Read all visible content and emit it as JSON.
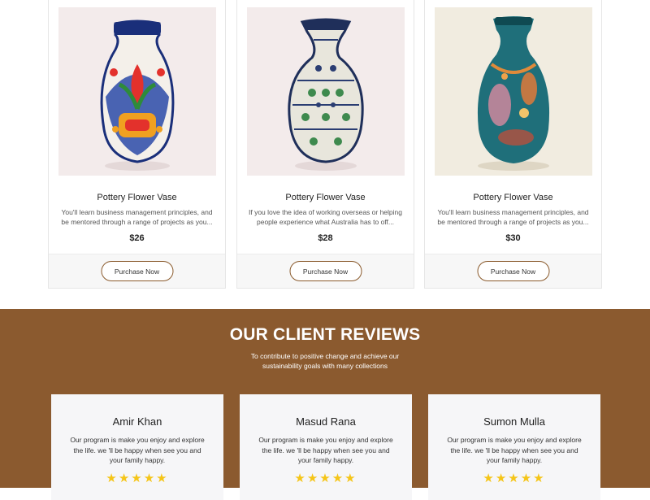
{
  "products": [
    {
      "title": "Pottery Flower Vase",
      "description": "You'll learn business management principles, and be mentored through a range of projects as you...",
      "price": "$26",
      "button": "Purchase Now"
    },
    {
      "title": "Pottery Flower Vase",
      "description": "If you love the idea of working overseas or helping people experience what Australia has to off...",
      "price": "$28",
      "button": "Purchase Now"
    },
    {
      "title": "Pottery Flower Vase",
      "description": "You'll learn business management principles, and be mentored through a range of projects as you...",
      "price": "$30",
      "button": "Purchase Now"
    }
  ],
  "reviews_section": {
    "heading": "OUR CLIENT REVIEWS",
    "subheading": "To contribute to positive change and achieve our sustainability goals with many collections",
    "reviews": [
      {
        "name": "Amir Khan",
        "text": "Our program is make you enjoy and explore the life. we 'll be happy when see you and your family happy.",
        "rating": 5
      },
      {
        "name": "Masud Rana",
        "text": "Our program is make you enjoy and explore the life. we 'll be happy when see you and your family happy.",
        "rating": 5
      },
      {
        "name": "Sumon Mulla",
        "text": "Our program is make you enjoy and explore the life. we 'll be happy when see you and your family happy.",
        "rating": 5
      }
    ]
  },
  "colors": {
    "brand_brown": "#8b5a2f",
    "star": "#f5c518",
    "button_border": "#8a5a2c"
  }
}
